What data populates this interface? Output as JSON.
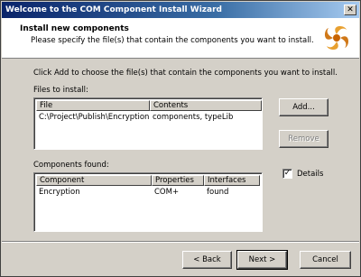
{
  "window": {
    "title": "Welcome to the COM Component Install Wizard",
    "close_symbol": "✕"
  },
  "header": {
    "title": "Install new components",
    "subtitle": "Please specify the file(s) that contain the components you want to install."
  },
  "instruction": "Click Add to choose the file(s) that contain the components you want to install.",
  "files": {
    "label": "Files to install:",
    "columns": [
      "File",
      "Contents"
    ],
    "rows": [
      {
        "file": "C:\\Project\\Publish\\Encryption...",
        "contents": "components, typeLib"
      }
    ]
  },
  "buttons": {
    "add": "Add...",
    "remove": "Remove",
    "back": "< Back",
    "next": "Next >",
    "cancel": "Cancel"
  },
  "components": {
    "label": "Components found:",
    "columns": [
      "Component",
      "Properties",
      "Interfaces"
    ],
    "rows": [
      {
        "component": "Encryption",
        "properties": "COM+",
        "interfaces": "found"
      }
    ]
  },
  "details": {
    "label": "Details",
    "checked": true,
    "check_symbol": "✓"
  },
  "icons": {
    "logo": "com-wizard-swirl-icon"
  }
}
